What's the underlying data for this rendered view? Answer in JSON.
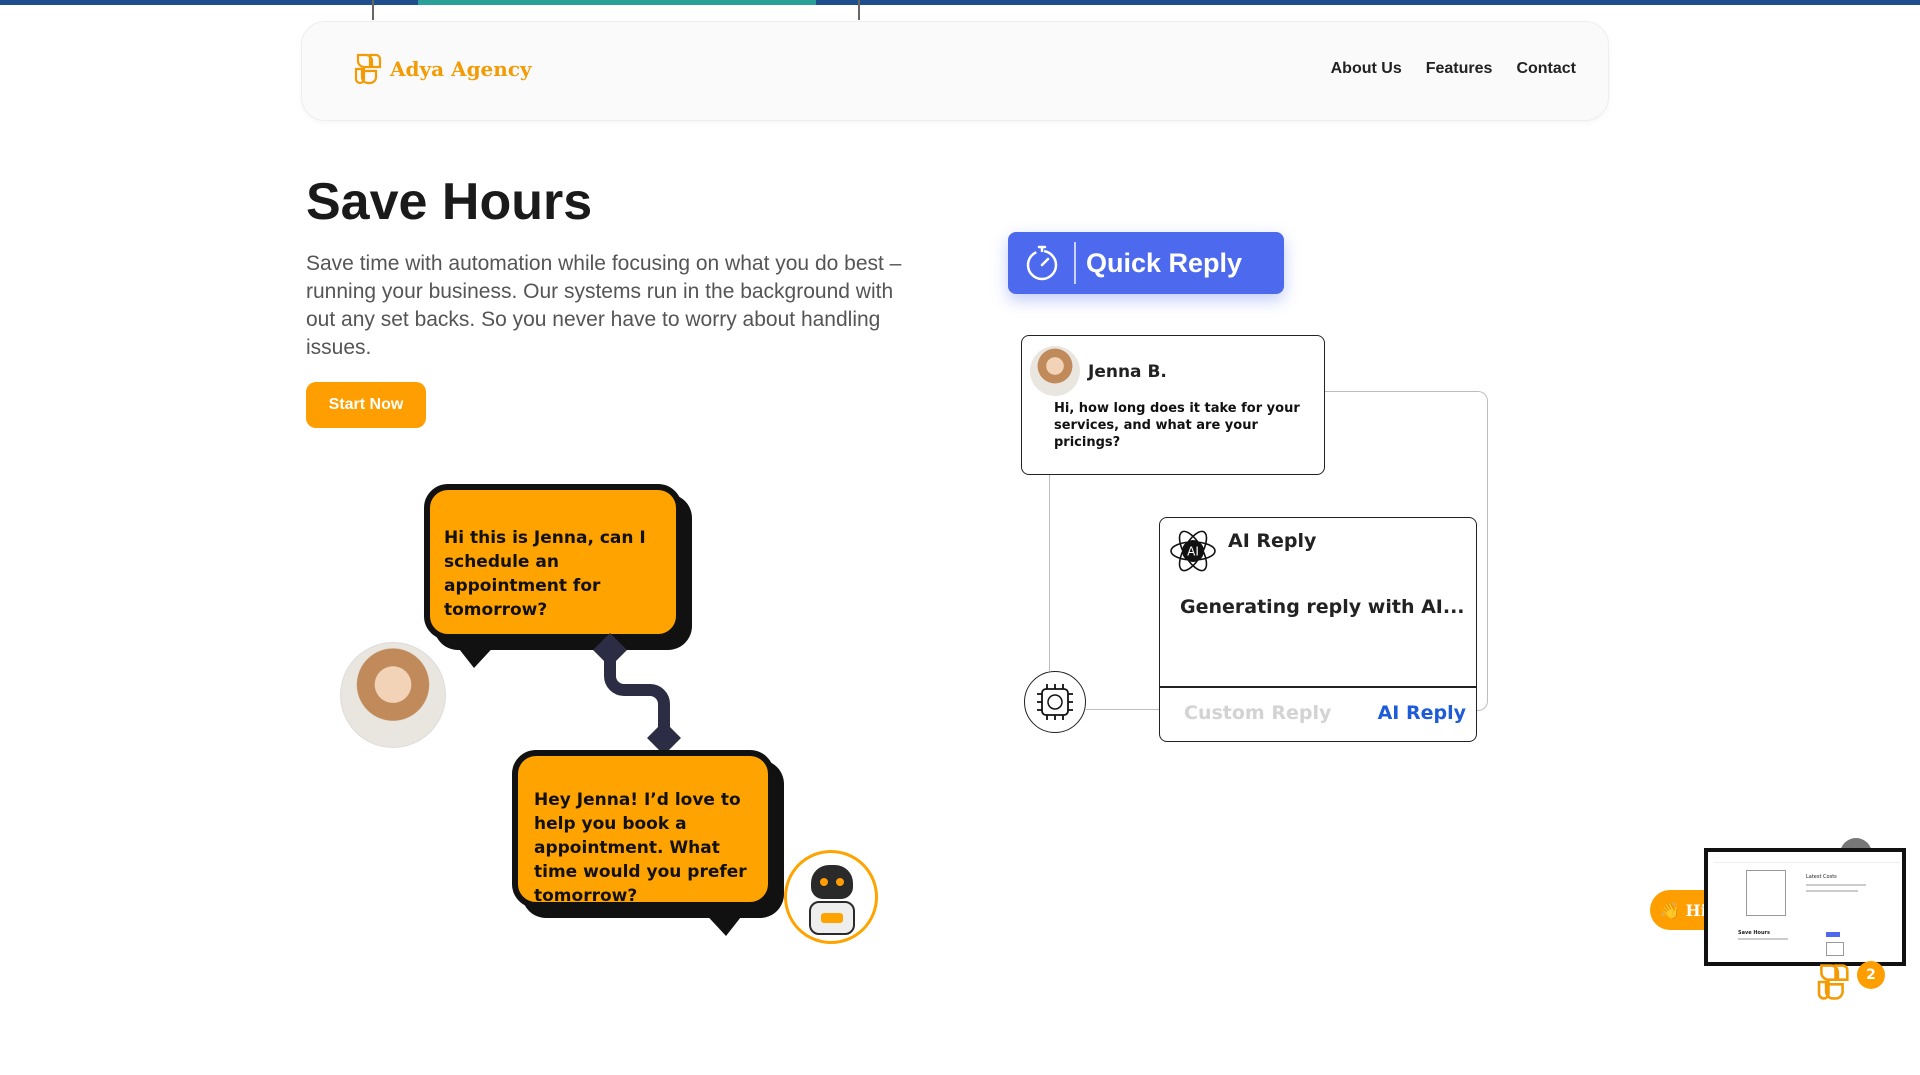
{
  "brand": {
    "name": "Adya Agency",
    "accent": "#f29b05"
  },
  "nav": {
    "items": [
      "About Us",
      "Features",
      "Contact"
    ]
  },
  "hero": {
    "title": "Save Hours",
    "description": "Save time with automation while focusing on what you do best – running your business. Our systems run in the background with out any set backs. So you never have to worry about handling issues.",
    "cta": "Start Now"
  },
  "chat": {
    "user_message": "Hi this is Jenna, can I schedule an appointment for tomorrow?",
    "bot_message": "Hey Jenna! I’d love to help you book a appointment. What time would you prefer tomorrow?"
  },
  "flow": {
    "badge_label": "Quick Reply",
    "incoming": {
      "name": "Jenna B.",
      "message": "Hi, how long does it take for your services, and what are your pricings?"
    },
    "ai_card": {
      "title": "AI Reply",
      "icon_text": "AI",
      "status": "Generating reply with AI...",
      "option_custom": "Custom Reply",
      "option_ai": "AI Reply"
    }
  },
  "widget": {
    "greeting": "👋 Hi",
    "badge_count": "2"
  },
  "preview": {
    "heading": "Save Hours",
    "subheading": "Latest Costs"
  }
}
